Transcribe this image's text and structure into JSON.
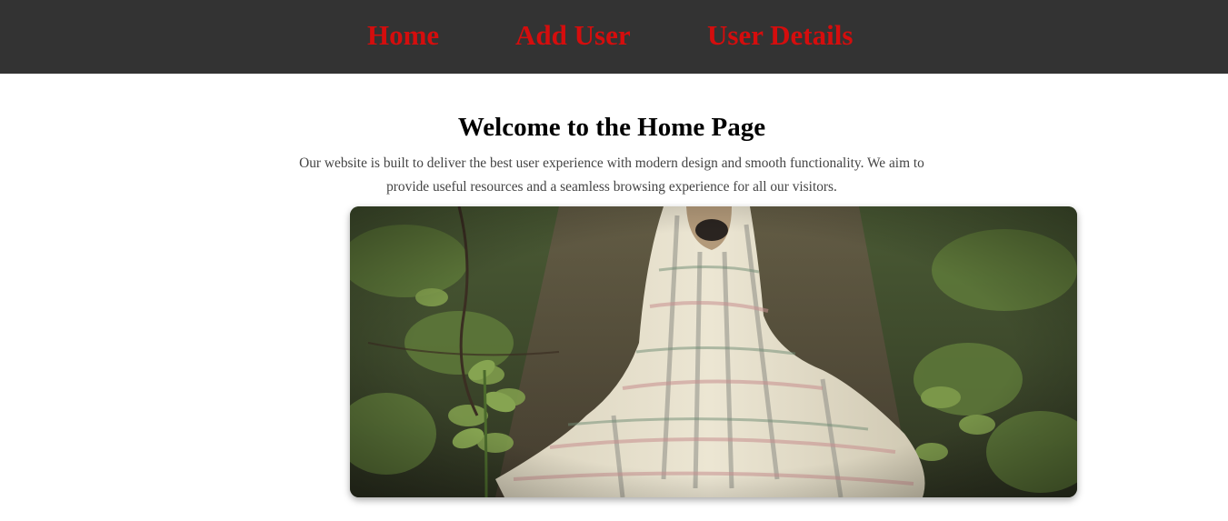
{
  "nav": {
    "links": [
      {
        "label": "Home"
      },
      {
        "label": "Add User"
      },
      {
        "label": "User Details"
      }
    ],
    "background_color": "#333333",
    "link_color": "#d50d0d"
  },
  "main": {
    "title": "Welcome to the Home Page",
    "intro": "Our website is built to deliver the best user experience with modern design and smooth functionality. We aim to provide useful resources and a seamless browsing experience for all our visitors."
  },
  "hero_image": {
    "subject": "pug wrapped in a plaid blanket sitting on a forest path"
  }
}
